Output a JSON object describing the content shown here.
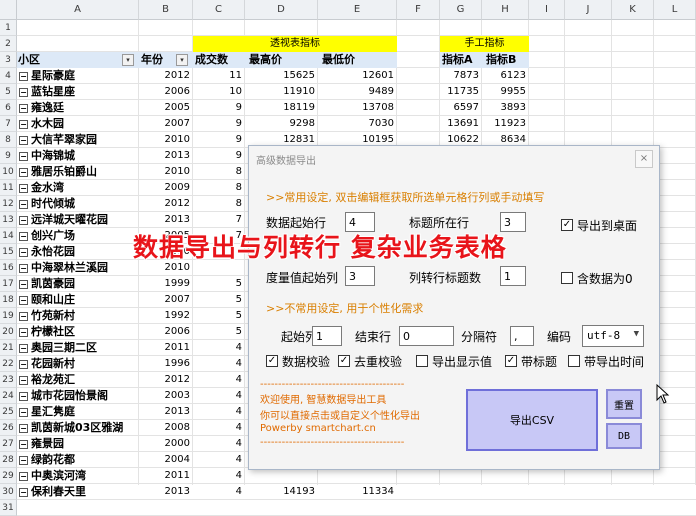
{
  "sheet": {
    "columns": [
      "A",
      "B",
      "C",
      "D",
      "E",
      "F",
      "G",
      "H",
      "I",
      "J",
      "K",
      "L"
    ],
    "row_numbers": [
      "1",
      "2",
      "3",
      "4",
      "5",
      "6",
      "7",
      "8",
      "9",
      "10",
      "11",
      "12",
      "13",
      "14",
      "15",
      "16",
      "17",
      "18",
      "19",
      "20",
      "21",
      "22",
      "23",
      "24",
      "25",
      "26",
      "27",
      "28",
      "29",
      "30",
      "31"
    ],
    "pivot_header": "透视表指标",
    "manual_header": "手工指标",
    "headers": {
      "xiaoqu": "小区",
      "nianfen": "年份",
      "chengjiao": "成交数",
      "zuigao": "最高价",
      "zuidi": "最低价",
      "zhibiaoA": "指标A",
      "zhibiaoB": "指标B"
    },
    "rows": [
      {
        "name": "星际豪庭",
        "year": "2012",
        "cnt": "11",
        "max": "15625",
        "min": "12601",
        "a": "7873",
        "b": "6123"
      },
      {
        "name": "蓝钻星座",
        "year": "2006",
        "cnt": "10",
        "max": "11910",
        "min": "9489",
        "a": "11735",
        "b": "9955"
      },
      {
        "name": "雍逸廷",
        "year": "2005",
        "cnt": "9",
        "max": "18119",
        "min": "13708",
        "a": "6597",
        "b": "3893"
      },
      {
        "name": "水木园",
        "year": "2007",
        "cnt": "9",
        "max": "9298",
        "min": "7030",
        "a": "13691",
        "b": "11923"
      },
      {
        "name": "大信芊翠家园",
        "year": "2010",
        "cnt": "9",
        "max": "12831",
        "min": "10195",
        "a": "10622",
        "b": "8634"
      },
      {
        "name": "中海锦城",
        "year": "2013",
        "cnt": "9",
        "max": "",
        "min": "",
        "a": "",
        "b": ""
      },
      {
        "name": "雅居乐铂爵山",
        "year": "2010",
        "cnt": "8",
        "max": "",
        "min": "",
        "a": "",
        "b": ""
      },
      {
        "name": "金水湾",
        "year": "2009",
        "cnt": "8",
        "max": "",
        "min": "",
        "a": "",
        "b": ""
      },
      {
        "name": "时代倾城",
        "year": "2012",
        "cnt": "8",
        "max": "",
        "min": "",
        "a": "",
        "b": ""
      },
      {
        "name": "远洋城天曜花园",
        "year": "2013",
        "cnt": "7",
        "max": "",
        "min": "",
        "a": "",
        "b": ""
      },
      {
        "name": "创兴广场",
        "year": "2005",
        "cnt": "7",
        "max": "",
        "min": "",
        "a": "",
        "b": ""
      },
      {
        "name": "永怡花园",
        "year": "2000",
        "cnt": "",
        "max": "",
        "min": "",
        "a": "",
        "b": ""
      },
      {
        "name": "中海翠林兰溪园",
        "year": "2010",
        "cnt": "",
        "max": "",
        "min": "",
        "a": "",
        "b": ""
      },
      {
        "name": "凯茵豪园",
        "year": "1999",
        "cnt": "5",
        "max": "",
        "min": "",
        "a": "",
        "b": ""
      },
      {
        "name": "颐和山庄",
        "year": "2007",
        "cnt": "5",
        "max": "",
        "min": "",
        "a": "",
        "b": ""
      },
      {
        "name": "竹苑新村",
        "year": "1992",
        "cnt": "5",
        "max": "",
        "min": "",
        "a": "",
        "b": ""
      },
      {
        "name": "柠檬社区",
        "year": "2006",
        "cnt": "5",
        "max": "",
        "min": "",
        "a": "",
        "b": ""
      },
      {
        "name": "奥园三期二区",
        "year": "2011",
        "cnt": "4",
        "max": "",
        "min": "",
        "a": "",
        "b": ""
      },
      {
        "name": "花园新村",
        "year": "1996",
        "cnt": "4",
        "max": "",
        "min": "",
        "a": "",
        "b": ""
      },
      {
        "name": "裕龙苑汇",
        "year": "2012",
        "cnt": "4",
        "max": "",
        "min": "",
        "a": "",
        "b": ""
      },
      {
        "name": "城市花园怡景阁",
        "year": "2003",
        "cnt": "4",
        "max": "",
        "min": "",
        "a": "",
        "b": ""
      },
      {
        "name": "星汇隽庭",
        "year": "2013",
        "cnt": "4",
        "max": "",
        "min": "",
        "a": "",
        "b": ""
      },
      {
        "name": "凯茵新城03区雅湖",
        "year": "2008",
        "cnt": "4",
        "max": "",
        "min": "",
        "a": "",
        "b": ""
      },
      {
        "name": "雍景园",
        "year": "2000",
        "cnt": "4",
        "max": "",
        "min": "",
        "a": "",
        "b": ""
      },
      {
        "name": "绿韵花都",
        "year": "2004",
        "cnt": "4",
        "max": "",
        "min": "",
        "a": "",
        "b": ""
      },
      {
        "name": "中奥滨河湾",
        "year": "2011",
        "cnt": "4",
        "max": "",
        "min": "",
        "a": "",
        "b": ""
      },
      {
        "name": "保利春天里",
        "year": "2013",
        "cnt": "4",
        "max": "14193",
        "min": "11334",
        "a": "",
        "b": ""
      }
    ]
  },
  "dialog": {
    "title": "高级数据导出",
    "close_label": "×",
    "section_common": ">>常用设定, 双击编辑框获取所选单元格行列或手动填写",
    "section_uncommon": ">>不常用设定, 用于个性化需求",
    "data_start_row_label": "数据起始行",
    "data_start_row_value": "4",
    "title_row_label": "标题所在行",
    "title_row_value": "3",
    "export_desktop_label": "导出到桌面",
    "export_desktop_checked": "✓",
    "measure_start_col_label": "度量值起始列",
    "measure_start_col_value": "3",
    "pivot_title_count_label": "列转行标题数",
    "pivot_title_count_value": "1",
    "include_zero_label": "含数据为0",
    "start_col_label": "起始列",
    "start_col_value": "1",
    "end_row_label": "结束行",
    "end_row_value": "0",
    "separator_label": "分隔符",
    "separator_value": ",",
    "encoding_label": "编码",
    "encoding_value": "utf-8",
    "data_check_label": "数据校验",
    "dedup_check_label": "去重校验",
    "show_value_label": "导出显示值",
    "with_title_label": "带标题",
    "with_time_label": "带导出时间",
    "check_mark": "✓",
    "dash_line": "----------------------------------------",
    "footer_1": "欢迎使用, 智慧数据导出工具",
    "footer_2": "你可以直接点击或自定义个性化导出",
    "footer_3": "Powerby smartchart.cn",
    "export_csv_label": "导出CSV",
    "reset_label": "重置",
    "db_label": "DB"
  },
  "overlay": {
    "headline": "数据导出与列转行 复杂业务表格"
  },
  "colors": {
    "pivot_header_bg": "#ffff00",
    "manual_header_bg": "#f8cbad",
    "section_text": "#d97f00",
    "headline": "#e8141a",
    "button_fill": "#c8c8f6"
  }
}
